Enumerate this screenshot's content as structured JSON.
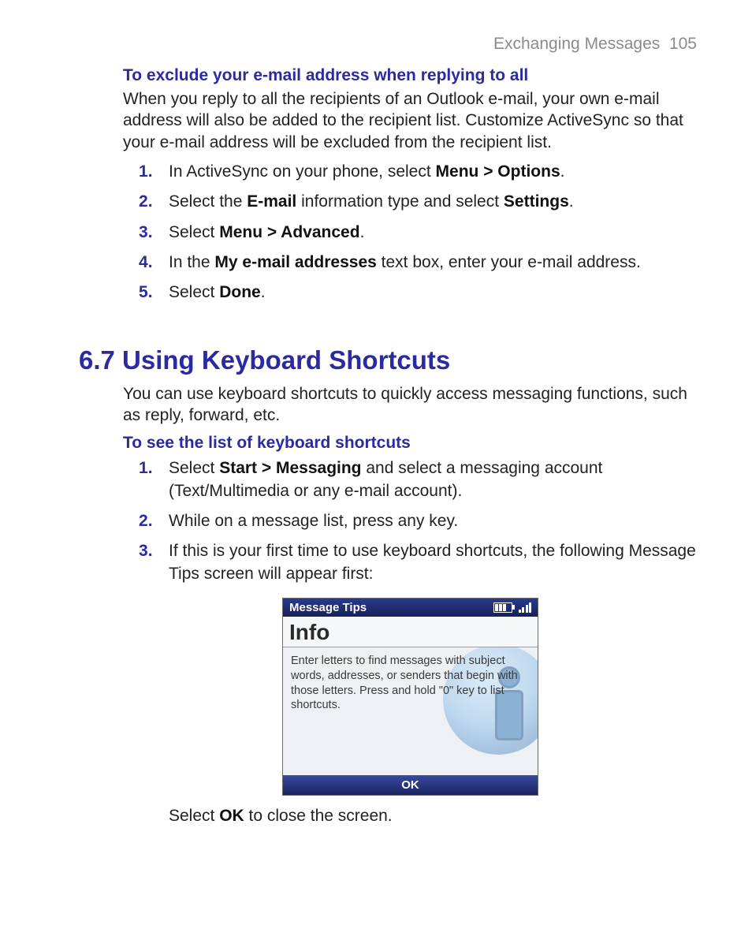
{
  "header": {
    "running": "Exchanging Messages",
    "page_no": "105"
  },
  "exclude": {
    "title": "To exclude your e-mail address when replying to all",
    "para": "When you reply to all the recipients of an Outlook e-mail, your own e-mail address will also be added to the recipient list. Customize ActiveSync so that your e-mail address will be excluded from the recipient list.",
    "steps": [
      {
        "pre": "In ActiveSync on your phone, select ",
        "b1": "Menu > Options",
        "post": "."
      },
      {
        "pre": "Select the ",
        "b1": "E-mail",
        "mid": " information type and select ",
        "b2": "Settings",
        "post": "."
      },
      {
        "pre": "Select ",
        "b1": "Menu > Advanced",
        "post": "."
      },
      {
        "pre": "In the ",
        "b1": "My e-mail addresses",
        "post": " text box, enter your e-mail address."
      },
      {
        "pre": "Select ",
        "b1": "Done",
        "post": "."
      }
    ]
  },
  "section67": {
    "title": "6.7 Using Keyboard Shortcuts",
    "intro": "You can use keyboard shortcuts to quickly access messaging functions, such as reply, forward, etc.",
    "subhead": "To see the list of keyboard shortcuts",
    "steps": [
      {
        "pre": "Select ",
        "b1": "Start > Messaging",
        "post": " and select a messaging account (Text/Multimedia or any e-mail account)."
      },
      {
        "pre": "While on a message list, press any key."
      },
      {
        "pre": "If this is your first time to use keyboard shortcuts, the following Message Tips screen will appear first:"
      }
    ],
    "phone": {
      "title": "Message Tips",
      "info_head": "Info",
      "body": "Enter letters to find messages with subject words, addresses, or senders that begin with those letters.  Press and hold \"0\" key to list shortcuts.",
      "softkey": "OK"
    },
    "after_fig_pre": "Select ",
    "after_fig_b": "OK",
    "after_fig_post": " to close the screen."
  }
}
